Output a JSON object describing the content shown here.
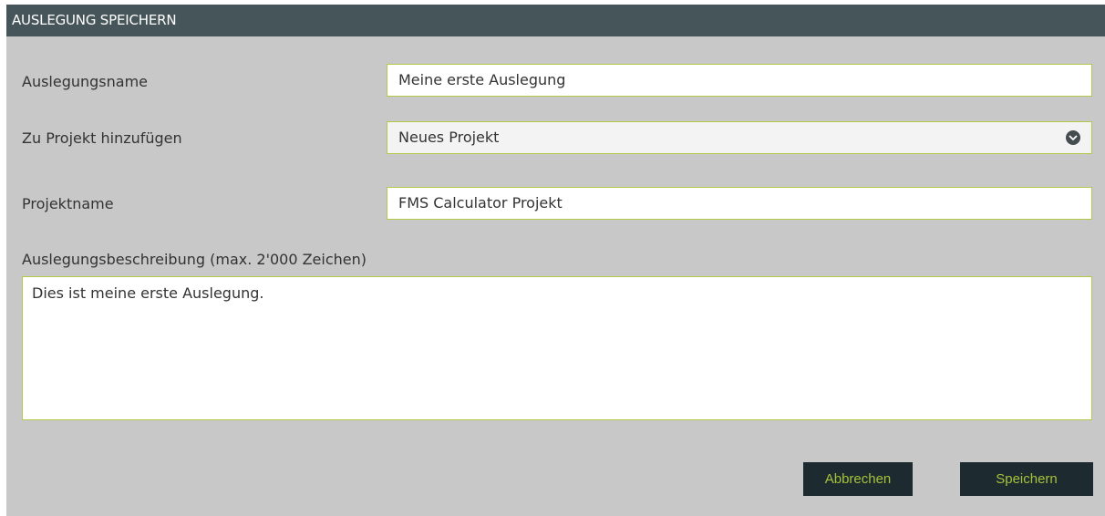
{
  "dialog": {
    "title": "AUSLEGUNG SPEICHERN"
  },
  "form": {
    "name_label": "Auslegungsname",
    "name_value": "Meine erste Auslegung",
    "project_label": "Zu Projekt hinzufügen",
    "project_value": "Neues Projekt",
    "projectname_label": "Projektname",
    "projectname_value": "FMS Calculator Projekt",
    "description_label": "Auslegungsbeschreibung (max. 2'000 Zeichen)",
    "description_value": "Dies ist meine erste Auslegung."
  },
  "buttons": {
    "cancel_label": "Abbrechen",
    "save_label": "Speichern"
  },
  "icons": {
    "dropdown": "chevron-down-icon"
  },
  "colors": {
    "titlebar": "#46555a",
    "background": "#c8c8c8",
    "field_border": "#b6c64a",
    "button_bg": "#1d2a30",
    "button_text": "#a6c13a"
  }
}
